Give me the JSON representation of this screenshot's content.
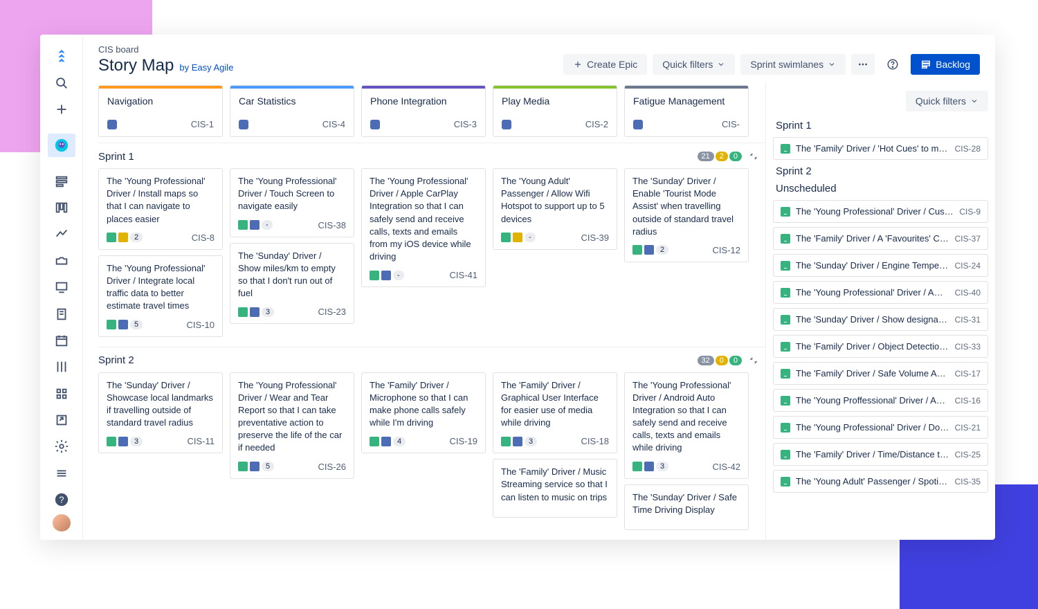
{
  "breadcrumb": "CIS board",
  "title": "Story Map",
  "byline": "by Easy Agile",
  "header_buttons": {
    "create_epic": "Create Epic",
    "quick_filters": "Quick filters",
    "swimlanes": "Sprint swimlanes",
    "backlog": "Backlog"
  },
  "epic_colors": [
    "#ff991f",
    "#4c9aff",
    "#6554c0",
    "#87c32f",
    "#6b778c"
  ],
  "epics": [
    {
      "name": "Navigation",
      "key": "CIS-1"
    },
    {
      "name": "Car Statistics",
      "key": "CIS-4"
    },
    {
      "name": "Phone Integration",
      "key": "CIS-3"
    },
    {
      "name": "Play Media",
      "key": "CIS-2"
    },
    {
      "name": "Fatigue Management",
      "key": "CIS-"
    }
  ],
  "sprints": [
    {
      "name": "Sprint 1",
      "counts": {
        "grey": "21",
        "yellow": "2",
        "green": "0"
      },
      "columns": [
        [
          {
            "text": "The 'Young Professional' Driver / Install maps so that I can navigate to places easier",
            "badges": [
              "green",
              "yellow"
            ],
            "num": "2",
            "key": "CIS-8"
          },
          {
            "text": "The 'Young Professional' Driver / Integrate local traffic data to better estimate travel times",
            "badges": [
              "green",
              "blue"
            ],
            "num": "5",
            "key": "CIS-10"
          }
        ],
        [
          {
            "text": "The 'Young Professional' Driver / Touch Screen to navigate easily",
            "badges": [
              "green",
              "blue"
            ],
            "num": "-",
            "key": "CIS-38"
          },
          {
            "text": "The 'Sunday' Driver / Show miles/km to empty so that I don't run out of fuel",
            "badges": [
              "green",
              "blue"
            ],
            "num": "3",
            "key": "CIS-23"
          }
        ],
        [
          {
            "text": "The 'Young Professional' Driver / Apple CarPlay Integration so that I can safely send and receive calls, texts and emails from my iOS device while driving",
            "badges": [
              "green",
              "blue"
            ],
            "num": "-",
            "key": "CIS-41"
          }
        ],
        [
          {
            "text": "The 'Young Adult' Passenger / Allow Wifi Hotspot to support up to 5 devices",
            "badges": [
              "green",
              "yellow"
            ],
            "num": "-",
            "key": "CIS-39"
          }
        ],
        [
          {
            "text": "The 'Sunday' Driver / Enable 'Tourist Mode Assist' when travelling outside of standard travel radius",
            "badges": [
              "green",
              "blue"
            ],
            "num": "2",
            "key": "CIS-12"
          }
        ]
      ]
    },
    {
      "name": "Sprint 2",
      "counts": {
        "grey": "32",
        "yellow": "0",
        "green": "0"
      },
      "columns": [
        [
          {
            "text": "The 'Sunday' Driver / Showcase local landmarks if travelling outside of standard travel radius",
            "badges": [
              "green",
              "blue"
            ],
            "num": "3",
            "key": "CIS-11"
          }
        ],
        [
          {
            "text": "The 'Young Professional' Driver / Wear and Tear Report so that I can take preventative action to preserve the life of the car if needed",
            "badges": [
              "green",
              "blue"
            ],
            "num": "5",
            "key": "CIS-26"
          }
        ],
        [
          {
            "text": "The 'Family' Driver / Microphone so that I can make phone calls safely while I'm driving",
            "badges": [
              "green",
              "blue"
            ],
            "num": "4",
            "key": "CIS-19"
          }
        ],
        [
          {
            "text": "The 'Family' Driver / Graphical User Interface for easier use of media while driving",
            "badges": [
              "green",
              "blue"
            ],
            "num": "3",
            "key": "CIS-18"
          },
          {
            "text": "The 'Family' Driver / Music Streaming service so that I can listen to music on trips",
            "badges": [],
            "num": "",
            "key": ""
          }
        ],
        [
          {
            "text": "The 'Young Professional' Driver / Android Auto Integration so that I can safely send and receive calls, texts and emails while driving",
            "badges": [
              "green",
              "blue"
            ],
            "num": "3",
            "key": "CIS-42"
          },
          {
            "text": "The 'Sunday' Driver / Safe Time Driving Display",
            "badges": [],
            "num": "",
            "key": ""
          }
        ]
      ]
    }
  ],
  "side_panel": {
    "quick_filters": "Quick filters",
    "sections": [
      {
        "title": "Sprint 1",
        "items": [
          {
            "text": "The 'Family' Driver / 'Hot Cues' to make …",
            "key": "CIS-28"
          }
        ]
      },
      {
        "title": "Sprint 2",
        "items": []
      },
      {
        "title": "Unscheduled",
        "items": [
          {
            "text": "The 'Young Professional' Driver / Custom…",
            "key": "CIS-9"
          },
          {
            "text": "The 'Family' Driver / A 'Favourites' Cont…",
            "key": "CIS-37"
          },
          {
            "text": "The 'Sunday' Driver / Engine Temperatu…",
            "key": "CIS-24"
          },
          {
            "text": "The 'Young Professional' Driver / Amaz…",
            "key": "CIS-40"
          },
          {
            "text": "The 'Sunday' Driver / Show designated '…",
            "key": "CIS-31"
          },
          {
            "text": "The 'Family' Driver / Object Detection fo…",
            "key": "CIS-33"
          },
          {
            "text": "The 'Family' Driver / Safe Volume Adjus…",
            "key": "CIS-17"
          },
          {
            "text": "The 'Young Proffessional' Driver / Aux C…",
            "key": "CIS-16"
          },
          {
            "text": "The 'Young Professional' Driver / Do No…",
            "key": "CIS-21"
          },
          {
            "text": "The 'Family' Driver / Time/Distance to m…",
            "key": "CIS-25"
          },
          {
            "text": "The 'Young Adult' Passenger / Spotify In…",
            "key": "CIS-35"
          }
        ]
      }
    ]
  },
  "badge_colors": {
    "green": "#36b37e",
    "blue": "#4c6db5",
    "yellow": "#e2b203"
  }
}
